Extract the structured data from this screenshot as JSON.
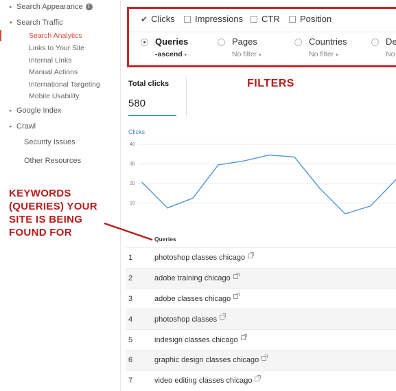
{
  "sidebar": {
    "items": [
      {
        "label": "Search Appearance",
        "type": "cat",
        "arrow": "▸",
        "info": "i"
      },
      {
        "label": "Search Traffic",
        "type": "cat",
        "arrow": "▾"
      },
      {
        "label": "Search Analytics",
        "type": "sub",
        "active": true
      },
      {
        "label": "Links to Your Site",
        "type": "sub"
      },
      {
        "label": "Internal Links",
        "type": "sub"
      },
      {
        "label": "Manual Actions",
        "type": "sub"
      },
      {
        "label": "International Targeting",
        "type": "sub"
      },
      {
        "label": "Mobile Usability",
        "type": "sub"
      },
      {
        "label": "Google Index",
        "type": "cat",
        "arrow": "▸"
      },
      {
        "label": "Crawl",
        "type": "cat",
        "arrow": "▸"
      },
      {
        "label": "Security Issues",
        "type": "plain"
      },
      {
        "label": "Other Resources",
        "type": "plain"
      }
    ]
  },
  "filters": {
    "metrics": [
      {
        "label": "Clicks",
        "checked": true
      },
      {
        "label": "Impressions",
        "checked": false
      },
      {
        "label": "CTR",
        "checked": false
      },
      {
        "label": "Position",
        "checked": false
      }
    ],
    "dimensions": [
      {
        "label": "Queries",
        "sub": "-ascend",
        "selected": true
      },
      {
        "label": "Pages",
        "sub": "No filter",
        "selected": false
      },
      {
        "label": "Countries",
        "sub": "No filter",
        "selected": false
      },
      {
        "label": "De",
        "sub": "No",
        "selected": false
      }
    ],
    "dropdown_icon": "caret-down-icon"
  },
  "totals": {
    "label": "Total clicks",
    "value": "580"
  },
  "annotations": {
    "filters": "FILTERS",
    "keywords": "KEYWORDS (QUERIES) YOUR SITE IS BEING FOUND FOR"
  },
  "chart_data": {
    "type": "line",
    "title": "Clicks",
    "xlabel": "",
    "ylabel": "",
    "yticks": [
      40,
      30,
      20,
      10
    ],
    "ylim": [
      0,
      40
    ],
    "x": [
      0,
      1,
      2,
      3,
      4,
      5,
      6,
      7,
      8,
      9,
      10
    ],
    "series": [
      {
        "values": [
          20.5,
          7.5,
          12.5,
          29.5,
          31.5,
          34.5,
          33.5,
          17.5,
          4.5,
          8.5,
          22
        ]
      }
    ],
    "color": "#5b9bd5",
    "grid": true
  },
  "table": {
    "header": "Queries",
    "rows": [
      {
        "index": "1",
        "query": "photoshop classes chicago"
      },
      {
        "index": "2",
        "query": "adobe training chicago"
      },
      {
        "index": "3",
        "query": "adobe classes chicago"
      },
      {
        "index": "4",
        "query": "photoshop classes"
      },
      {
        "index": "5",
        "query": "indesign classes chicago"
      },
      {
        "index": "6",
        "query": "graphic design classes chicago"
      },
      {
        "index": "7",
        "query": "video editing classes chicago"
      }
    ],
    "link_icon": "external-link-icon"
  },
  "colors": {
    "accent": "#d14836",
    "annotation": "#b71c1c",
    "chart_line": "#5b9bd5"
  }
}
